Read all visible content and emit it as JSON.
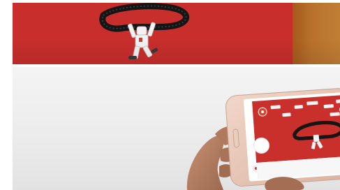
{
  "scene": {
    "top_photo": "figurine-hanging-from-belt",
    "bottom_photo": "phone-camera-view",
    "colors": {
      "red_surface": "#c72e2c",
      "wood": "#b8712c",
      "belt": "#1c1c1c",
      "figurine": "#f2f2f2",
      "phone_body": "#e8c8b8",
      "skin": "#b98468"
    },
    "icons": [
      "shutter-button-icon",
      "record-icon",
      "thumbnail-icon"
    ]
  }
}
